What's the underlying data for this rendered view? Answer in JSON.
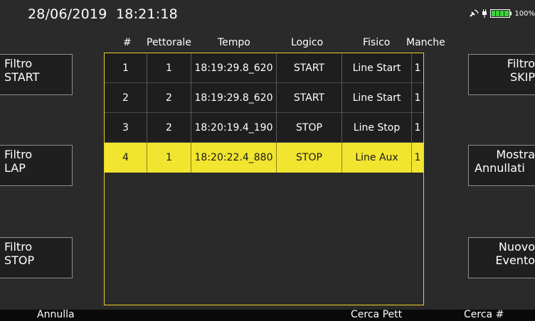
{
  "status": {
    "datetime": "28/06/2019  18:21:18",
    "battery_text": "100%"
  },
  "table": {
    "headers": [
      "#",
      "Pettorale",
      "Tempo",
      "Logico",
      "Fisico",
      "Manche"
    ],
    "rows": [
      {
        "num": "1",
        "pettorale": "1",
        "tempo": "18:19:29.8_620",
        "logico": "START",
        "fisico": "Line Start",
        "manche": "1",
        "selected": false
      },
      {
        "num": "2",
        "pettorale": "2",
        "tempo": "18:19:29.8_620",
        "logico": "START",
        "fisico": "Line Start",
        "manche": "1",
        "selected": false
      },
      {
        "num": "3",
        "pettorale": "2",
        "tempo": "18:20:19.4_190",
        "logico": "STOP",
        "fisico": "Line Stop",
        "manche": "1",
        "selected": false
      },
      {
        "num": "4",
        "pettorale": "1",
        "tempo": "18:20:22.4_880",
        "logico": "STOP",
        "fisico": "Line Aux",
        "manche": "1",
        "selected": true
      }
    ]
  },
  "left_buttons": [
    {
      "line1": "Filtro",
      "line2": "START"
    },
    {
      "line1": "Filtro",
      "line2": "LAP"
    },
    {
      "line1": "Filtro",
      "line2": "STOP"
    }
  ],
  "right_buttons": [
    {
      "line1": "Filtro",
      "line2": "SKIP"
    },
    {
      "line1": "Mostra",
      "line2": "Annullati"
    },
    {
      "line1": "Nuovo",
      "line2": "Evento"
    }
  ],
  "bottom_bar": {
    "annulla": "Annulla",
    "cerca_pett": "Cerca Pett",
    "cerca_num": "Cerca #"
  },
  "colors": {
    "background": "#2a2a2a",
    "table_border": "#e8d21e",
    "selected_row": "#f1e52f",
    "row_bg": "#1e1e1e",
    "battery": "#3bd13b"
  }
}
